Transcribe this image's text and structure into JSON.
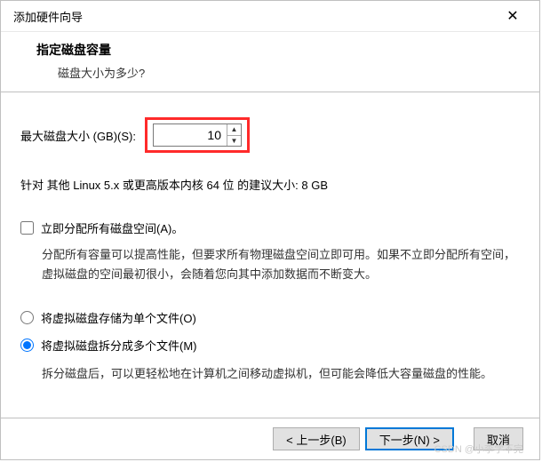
{
  "window": {
    "title": "添加硬件向导",
    "close_label": "✕"
  },
  "header": {
    "title": "指定磁盘容量",
    "subtitle": "磁盘大小为多少?"
  },
  "disk": {
    "max_label": "最大磁盘大小 (GB)(S):",
    "value": "10",
    "recommend": "针对 其他 Linux 5.x 或更高版本内核 64 位 的建议大小: 8 GB"
  },
  "allocate": {
    "label": "立即分配所有磁盘空间(A)。",
    "desc": "分配所有容量可以提高性能，但要求所有物理磁盘空间立即可用。如果不立即分配所有空间，虚拟磁盘的空间最初很小，会随着您向其中添加数据而不断变大。"
  },
  "store": {
    "single_label": "将虚拟磁盘存储为单个文件(O)",
    "split_label": "将虚拟磁盘拆分成多个文件(M)",
    "split_desc": "拆分磁盘后，可以更轻松地在计算机之间移动虚拟机，但可能会降低大容量磁盘的性能。"
  },
  "buttons": {
    "back": "< 上一步(B)",
    "next": "下一步(N) >",
    "cancel": "取消"
  },
  "watermark": "CSDN @小李学不完"
}
